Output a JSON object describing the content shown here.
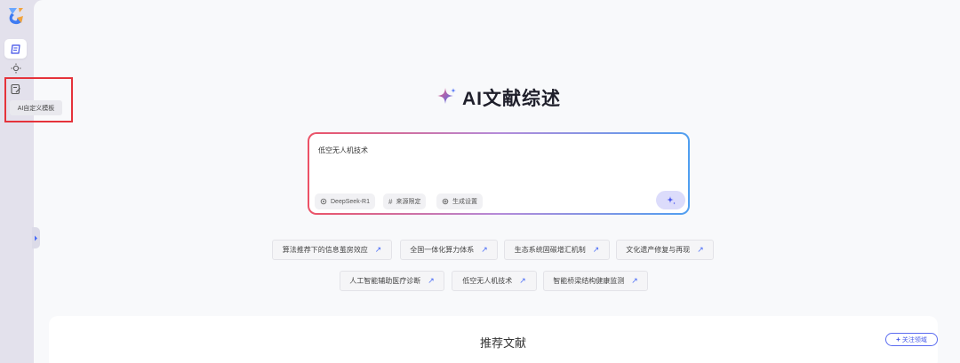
{
  "sidebar": {
    "logo_icon": "app-logo",
    "items": [
      {
        "icon": "document-icon",
        "active": true
      },
      {
        "icon": "sun-icon",
        "active": false
      },
      {
        "icon": "edit-template-icon",
        "active": false
      }
    ],
    "tooltip": "AI自定义模板",
    "collapse_icon": "chevron-right-icon"
  },
  "main": {
    "title": "AI文献综述",
    "title_icon": "sparkle-icon",
    "search": {
      "value": "低空无人机技术",
      "chips": [
        {
          "label": "DeepSeek-R1",
          "icon": "gear-icon"
        },
        {
          "label": "来源限定",
          "icon": "hash-icon"
        },
        {
          "label": "生成设置",
          "icon": "settings-icon"
        }
      ],
      "send_icon": "sparkle-icon"
    },
    "suggestions": [
      "算法推荐下的信息茧房效应",
      "全国一体化算力体系",
      "生态系统固碳增汇机制",
      "文化遗产修复与再现",
      "人工智能辅助医疗诊断",
      "低空无人机技术",
      "智能桥梁结构健康监测"
    ],
    "recommended": {
      "title": "推荐文献",
      "follow_button": "关注领域",
      "follow_icon": "plus-icon"
    }
  },
  "colors": {
    "accent": "#5b6cf0",
    "highlight": "#e5333b",
    "gradient_start": "#ec5266",
    "gradient_end": "#4f9ff0"
  }
}
